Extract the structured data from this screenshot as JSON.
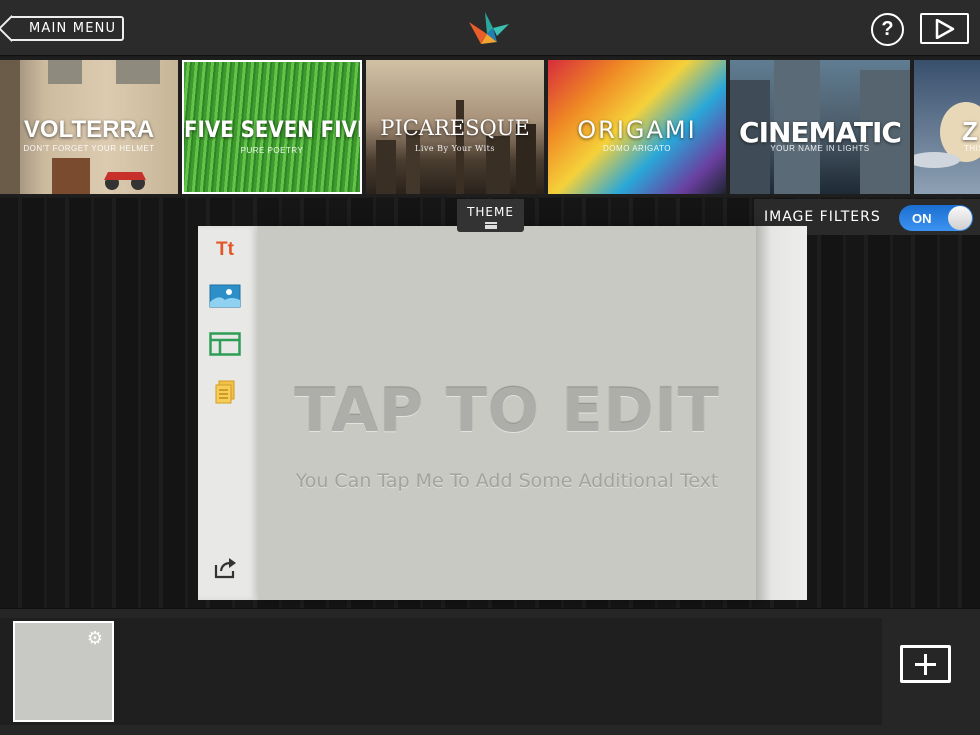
{
  "topbar": {
    "main_menu_label": "MAIN MENU",
    "help_label": "?",
    "logo_icon": "origami-bird-logo",
    "play_icon": "play-icon"
  },
  "themes": [
    {
      "name": "VOLTERRA",
      "tagline": "Don't forget your helmet"
    },
    {
      "name": "FIVE SEVEN FIVE",
      "tagline": "Pure Poetry",
      "selected": true
    },
    {
      "name": "PICARESQUE",
      "tagline": "Live By Your Wits"
    },
    {
      "name": "ORIGAMI",
      "tagline": "Domo Arigato"
    },
    {
      "name": "CINEMATIC",
      "tagline": "Your Name In Lights"
    },
    {
      "name": "Z",
      "tagline": "This"
    }
  ],
  "theme_tab": {
    "label": "THEME"
  },
  "image_filters": {
    "label": "IMAGE FILTERS",
    "state": "ON",
    "accent": "#2a85e8"
  },
  "slide": {
    "title": "TAP TO EDIT",
    "subtitle": "You Can Tap Me To Add Some Additional Text",
    "tools": [
      "text-icon",
      "image-icon",
      "layout-icon",
      "notes-icon",
      "share-icon"
    ],
    "text_tool_label": "Tt",
    "text_tool_color": "#e3562a"
  },
  "timeline": {
    "thumb_gear_icon": "gear-icon",
    "add_icon": "plus-icon"
  }
}
